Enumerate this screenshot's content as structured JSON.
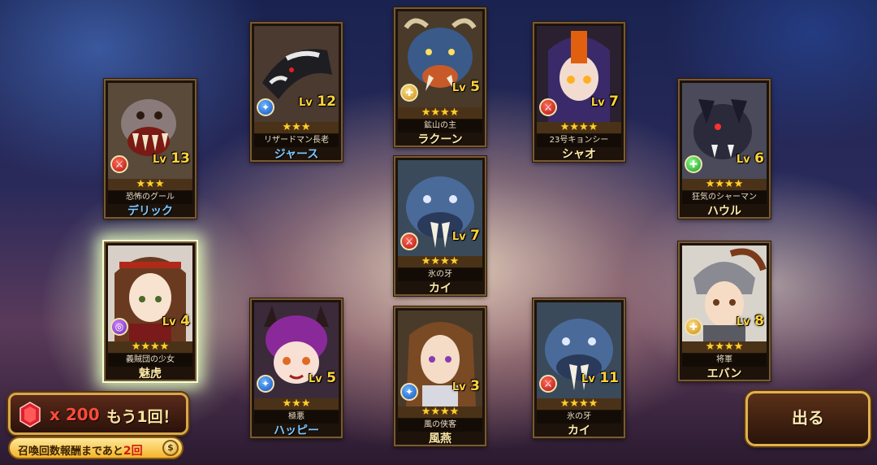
{
  "screen": "summon_results",
  "units": [
    {
      "id": "u1",
      "title": "恐怖のグール",
      "name": "デリック",
      "level": "13",
      "stars": 3,
      "class_icon": "sword-icon",
      "class_color": "red",
      "name_color": "blue"
    },
    {
      "id": "u2",
      "title": "リザードマン長老",
      "name": "ジャース",
      "level": "12",
      "stars": 3,
      "class_icon": "staff-icon",
      "class_color": "blue",
      "name_color": "blue"
    },
    {
      "id": "u3",
      "title": "鉱山の主",
      "name": "ラクーン",
      "level": "5",
      "stars": 4,
      "class_icon": "shield-icon",
      "class_color": "gold",
      "name_color": "gold"
    },
    {
      "id": "u4",
      "title": "23号キョンシー",
      "name": "シャオ",
      "level": "7",
      "stars": 4,
      "class_icon": "sword-icon",
      "class_color": "red",
      "name_color": "gold"
    },
    {
      "id": "u5",
      "title": "狂気のシャーマン",
      "name": "ハウル",
      "level": "6",
      "stars": 4,
      "class_icon": "cross-icon",
      "class_color": "green",
      "name_color": "gold"
    },
    {
      "id": "u6",
      "title": "氷の牙",
      "name": "カイ",
      "level": "7",
      "stars": 4,
      "class_icon": "sword-icon",
      "class_color": "red",
      "name_color": "gold"
    },
    {
      "id": "u7",
      "title": "義賊団の少女",
      "name": "魅虎",
      "level": "4",
      "stars": 4,
      "class_icon": "vortex-icon",
      "class_color": "purple",
      "name_color": "gold"
    },
    {
      "id": "u8",
      "title": "極悪",
      "name": "ハッピー",
      "level": "5",
      "stars": 3,
      "class_icon": "staff-icon",
      "class_color": "blue",
      "name_color": "blue"
    },
    {
      "id": "u9",
      "title": "風の侠客",
      "name": "風燕",
      "level": "3",
      "stars": 4,
      "class_icon": "staff-icon",
      "class_color": "blue",
      "name_color": "gold"
    },
    {
      "id": "u10",
      "title": "氷の牙",
      "name": "カイ",
      "level": "11",
      "stars": 4,
      "class_icon": "sword-icon",
      "class_color": "red",
      "name_color": "gold"
    },
    {
      "id": "u11",
      "title": "将軍",
      "name": "エバン",
      "level": "8",
      "stars": 4,
      "class_icon": "shield-icon",
      "class_color": "gold",
      "name_color": "gold"
    }
  ],
  "level_prefix": "Lv",
  "retry": {
    "cost": "x 200",
    "label": "もう1回！",
    "gem_icon": "ruby-gem-icon"
  },
  "bonus": {
    "text_before": "召喚回数報酬まであと",
    "count": "2回"
  },
  "exit_button": "出る",
  "colors": {
    "gold_text": "#ffe9a8",
    "blue_text": "#7ec6ff",
    "frame": "#7a5a34",
    "star": "#ffcf2e"
  }
}
